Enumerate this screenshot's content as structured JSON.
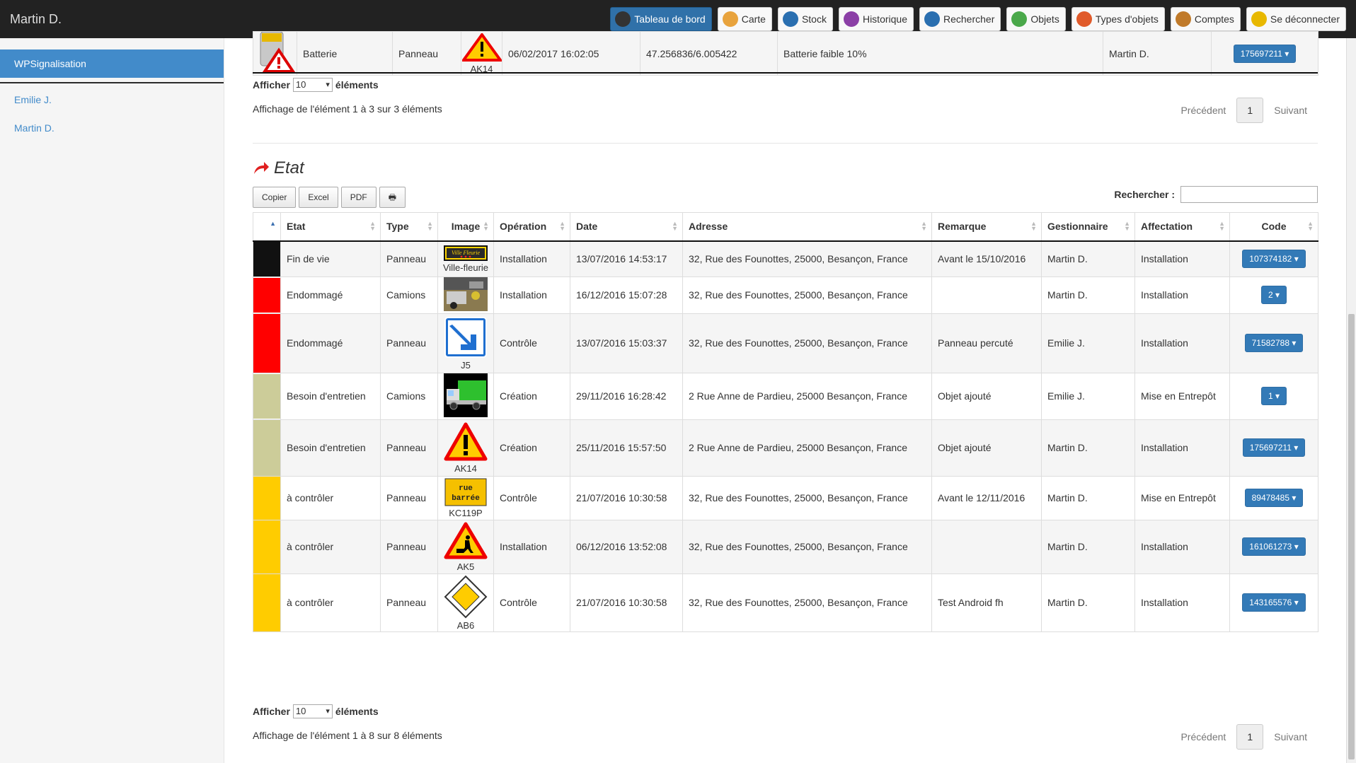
{
  "user": "Martin D.",
  "nav": [
    {
      "label": "Tableau de bord",
      "icon": "dashboard-icon",
      "color": "#333"
    },
    {
      "label": "Carte",
      "icon": "map-icon",
      "color": "#e8a33d"
    },
    {
      "label": "Stock",
      "icon": "cart-icon",
      "color": "#2a6fb0"
    },
    {
      "label": "Historique",
      "icon": "history-icon",
      "color": "#8b3fa6"
    },
    {
      "label": "Rechercher",
      "icon": "search-icon",
      "color": "#2a6fb0"
    },
    {
      "label": "Objets",
      "icon": "objects-icon",
      "color": "#4aa84a"
    },
    {
      "label": "Types d'objets",
      "icon": "object-types-icon",
      "color": "#e05a2a"
    },
    {
      "label": "Comptes",
      "icon": "accounts-icon",
      "color": "#c07a2a"
    },
    {
      "label": "Se déconnecter",
      "icon": "logout-icon",
      "color": "#e8b800"
    }
  ],
  "sidebar": {
    "active": "WPSignalisation",
    "links": [
      "Emilie J.",
      "Martin D."
    ]
  },
  "top_table": {
    "row": {
      "name": "Batterie",
      "type": "Panneau",
      "image_caption": "AK14",
      "date": "06/02/2017 16:02:05",
      "coords": "47.256836/6.005422",
      "remark": "Batterie faible 10%",
      "manager": "Martin D.",
      "code": "175697211"
    },
    "length_label_before": "Afficher",
    "length_value": "10",
    "length_label_after": "éléments",
    "info": "Affichage de l'élément 1 à 3 sur 3 éléments",
    "prev": "Précédent",
    "page": "1",
    "next": "Suivant"
  },
  "etat": {
    "title": "Etat",
    "tools": [
      "Copier",
      "Excel",
      "PDF"
    ],
    "search_label": "Rechercher :",
    "columns": [
      "",
      "Etat",
      "Type",
      "Image",
      "Opération",
      "Date",
      "Adresse",
      "Remarque",
      "Gestionnaire",
      "Affectation",
      "Code"
    ],
    "rows": [
      {
        "color": "#111111",
        "etat": "Fin de vie",
        "type": "Panneau",
        "img": "ville-fleurie",
        "caption": "Ville-fleurie",
        "op": "Installation",
        "date": "13/07/2016 14:53:17",
        "addr": "32, Rue des Founottes, 25000, Besançon, France",
        "rem": "Avant le 15/10/2016",
        "mgr": "Martin D.",
        "aff": "Installation",
        "code": "107374182"
      },
      {
        "color": "#ff0000",
        "etat": "Endommagé",
        "type": "Camions",
        "img": "photo",
        "caption": "",
        "op": "Installation",
        "date": "16/12/2016 15:07:28",
        "addr": "32, Rue des Founottes, 25000, Besançon, France",
        "rem": "",
        "mgr": "Martin D.",
        "aff": "Installation",
        "code": "2"
      },
      {
        "color": "#ff0000",
        "etat": "Endommagé",
        "type": "Panneau",
        "img": "j5",
        "caption": "J5",
        "op": "Contrôle",
        "date": "13/07/2016 15:03:37",
        "addr": "32, Rue des Founottes, 25000, Besançon, France",
        "rem": "Panneau percuté",
        "mgr": "Emilie J.",
        "aff": "Installation",
        "code": "71582788"
      },
      {
        "color": "#cccc99",
        "etat": "Besoin d'entretien",
        "type": "Camions",
        "img": "truck",
        "caption": "",
        "op": "Création",
        "date": "29/11/2016 16:28:42",
        "addr": "2 Rue Anne de Pardieu, 25000 Besançon, France",
        "rem": "Objet ajouté",
        "mgr": "Emilie J.",
        "aff": "Mise en Entrepôt",
        "code": "1"
      },
      {
        "color": "#cccc99",
        "etat": "Besoin d'entretien",
        "type": "Panneau",
        "img": "ak14",
        "caption": "AK14",
        "op": "Création",
        "date": "25/11/2016 15:57:50",
        "addr": "2 Rue Anne de Pardieu, 25000 Besançon, France",
        "rem": "Objet ajouté",
        "mgr": "Martin D.",
        "aff": "Installation",
        "code": "175697211"
      },
      {
        "color": "#ffcc00",
        "etat": "à contrôler",
        "type": "Panneau",
        "img": "kc119p",
        "caption": "KC119P",
        "op": "Contrôle",
        "date": "21/07/2016 10:30:58",
        "addr": "32, Rue des Founottes, 25000, Besançon, France",
        "rem": "Avant le 12/11/2016",
        "mgr": "Martin D.",
        "aff": "Mise en Entrepôt",
        "code": "89478485"
      },
      {
        "color": "#ffcc00",
        "etat": "à contrôler",
        "type": "Panneau",
        "img": "ak5",
        "caption": "AK5",
        "op": "Installation",
        "date": "06/12/2016 13:52:08",
        "addr": "32, Rue des Founottes, 25000, Besançon, France",
        "rem": "",
        "mgr": "Martin D.",
        "aff": "Installation",
        "code": "161061273"
      },
      {
        "color": "#ffcc00",
        "etat": "à contrôler",
        "type": "Panneau",
        "img": "ab6",
        "caption": "AB6",
        "op": "Contrôle",
        "date": "21/07/2016 10:30:58",
        "addr": "32, Rue des Founottes, 25000, Besançon, France",
        "rem": "Test Android fh",
        "mgr": "Martin D.",
        "aff": "Installation",
        "code": "143165576"
      }
    ],
    "length_label_before": "Afficher",
    "length_value": "10",
    "length_label_after": "éléments",
    "info": "Affichage de l'élément 1 à 8 sur 8 éléments",
    "prev": "Précédent",
    "page": "1",
    "next": "Suivant",
    "ville_fleurie_text": "Ville Fleurie",
    "kc119p_text": [
      "rue",
      "barrée"
    ]
  }
}
